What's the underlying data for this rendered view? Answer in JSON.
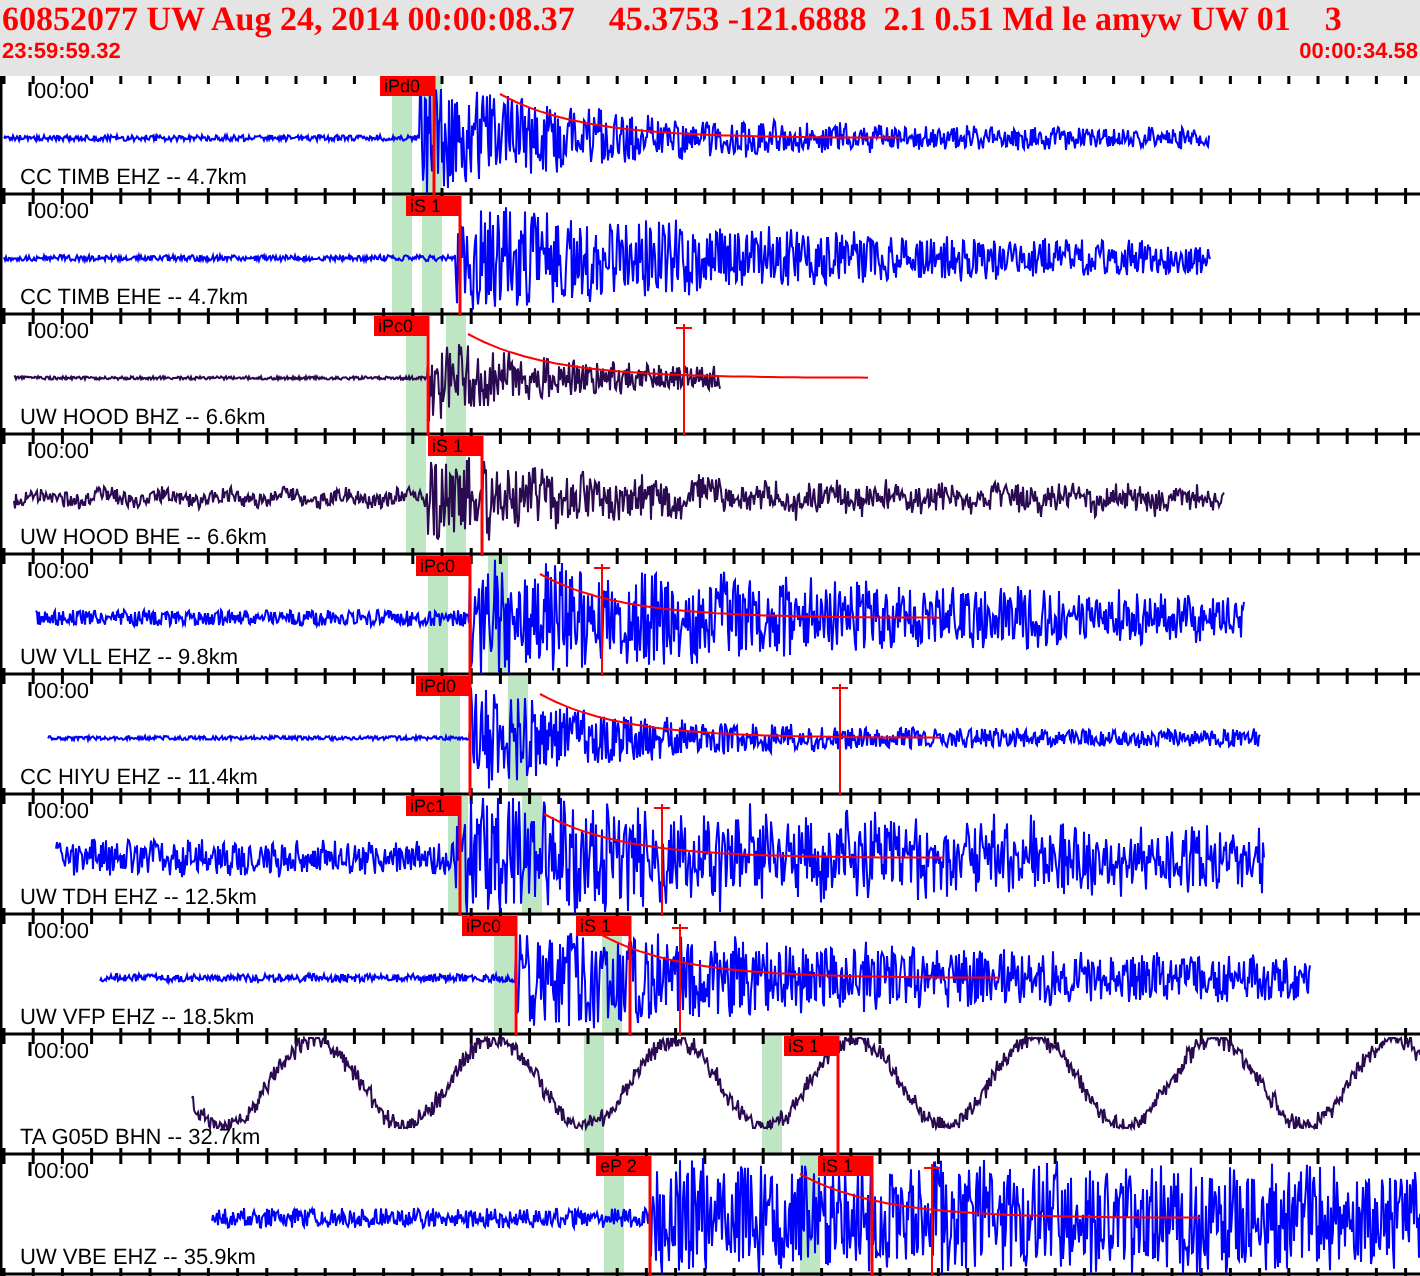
{
  "header": {
    "title": "60852077 UW Aug 24, 2014 00:00:08.37    45.3753 -121.6888  2.1 0.51 Md le amyw UW 01    3",
    "start_time": "23:59:59.32",
    "end_time": "00:00:34.58"
  },
  "traces": [
    {
      "time_label": "00:00",
      "label": "CC TIMB EHZ -- 4.7km",
      "color": "#0000ff",
      "picks": [
        {
          "label": "iPd0"
        }
      ]
    },
    {
      "time_label": "00:00",
      "label": "CC TIMB EHE -- 4.7km",
      "color": "#0000ff",
      "picks": [
        {
          "label": "iS 1"
        }
      ]
    },
    {
      "time_label": "00:00",
      "label": "UW HOOD BHZ -- 6.6km",
      "color": "#2a0a50",
      "picks": [
        {
          "label": "iPc0"
        }
      ]
    },
    {
      "time_label": "00:00",
      "label": "UW HOOD BHE -- 6.6km",
      "color": "#2a0a50",
      "picks": [
        {
          "label": "iS 1"
        }
      ]
    },
    {
      "time_label": "00:00",
      "label": "UW VLL EHZ -- 9.8km",
      "color": "#0000ff",
      "picks": [
        {
          "label": "iPc0"
        }
      ]
    },
    {
      "time_label": "00:00",
      "label": "CC HIYU EHZ -- 11.4km",
      "color": "#0000ff",
      "picks": [
        {
          "label": "iPd0"
        }
      ]
    },
    {
      "time_label": "00:00",
      "label": "UW TDH EHZ -- 12.5km",
      "color": "#0000ff",
      "picks": [
        {
          "label": "iPc1"
        }
      ]
    },
    {
      "time_label": "00:00",
      "label": "UW VFP EHZ -- 18.5km",
      "color": "#0000ff",
      "picks": [
        {
          "label": "iPc0"
        },
        {
          "label": "iS 1"
        }
      ]
    },
    {
      "time_label": "00:00",
      "label": "TA G05D BHN -- 32.7km",
      "color": "#2a0a50",
      "picks": [
        {
          "label": "iS 1"
        }
      ]
    },
    {
      "time_label": "00:00",
      "label": "UW VBE EHZ -- 35.9km",
      "color": "#0000ff",
      "picks": [
        {
          "label": "eP 2"
        },
        {
          "label": "iS 1"
        }
      ]
    }
  ]
}
